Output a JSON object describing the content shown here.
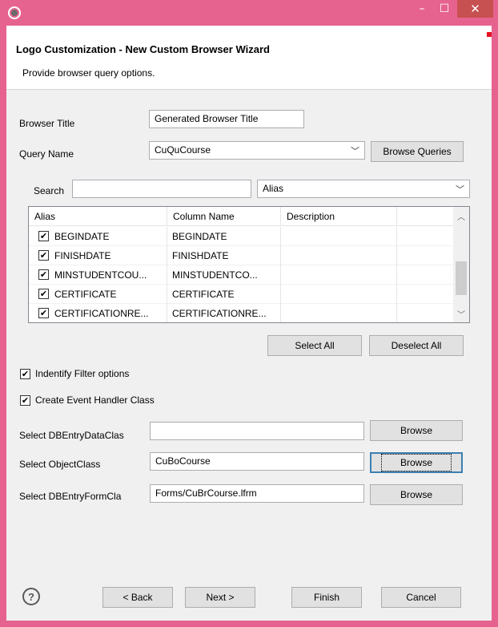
{
  "window": {
    "title": "",
    "controls": {
      "minimize": "–",
      "maximize": "☐",
      "close": "✕"
    }
  },
  "header": {
    "title": "Logo Customization - New Custom Browser Wizard",
    "subtitle": "Provide browser query options."
  },
  "form": {
    "browser_title_label": "Browser Title",
    "browser_title_value": "Generated Browser Title",
    "query_name_label": "Query Name",
    "query_name_value": "CuQuCourse",
    "browse_queries_button": "Browse Queries",
    "search_label": "Search",
    "search_value": "",
    "search_by_value": "Alias"
  },
  "table": {
    "columns": [
      "Alias",
      "Column Name",
      "Description"
    ],
    "rows": [
      {
        "checked": true,
        "alias": "BEGINDATE",
        "column_name": "BEGINDATE",
        "description": ""
      },
      {
        "checked": true,
        "alias": "FINISHDATE",
        "column_name": "FINISHDATE",
        "description": ""
      },
      {
        "checked": true,
        "alias": "MINSTUDENTCOU...",
        "column_name": "MINSTUDENTCO...",
        "description": ""
      },
      {
        "checked": true,
        "alias": "CERTIFICATE",
        "column_name": "CERTIFICATE",
        "description": ""
      },
      {
        "checked": true,
        "alias": "CERTIFICATIONRE...",
        "column_name": "CERTIFICATIONRE...",
        "description": ""
      }
    ]
  },
  "selection": {
    "select_all": "Select All",
    "deselect_all": "Deselect All"
  },
  "options": {
    "identify_filter": {
      "label": "Indentify Filter options",
      "checked": true
    },
    "create_event_handler": {
      "label": "Create Event Handler Class",
      "checked": true
    }
  },
  "classes": {
    "dbentry_data_label": "Select DBEntryDataClas",
    "dbentry_data_value": "",
    "object_class_label": "Select ObjectClass",
    "object_class_value": "CuBoCourse",
    "dbentry_form_label": "Select DBEntryFormCla",
    "dbentry_form_value": "Forms/CuBrCourse.lfrm",
    "browse_button": "Browse"
  },
  "footer": {
    "help_icon": "?",
    "back": "Back",
    "next": "Next >",
    "finish": "Finish",
    "cancel": "Cancel"
  },
  "icons": {
    "check": "✔",
    "dropdown": "chevron-down-icon"
  },
  "colors": {
    "title_bar": "#e6638f",
    "close_button": "#c75050",
    "dialog_bg": "#f0f0f0"
  }
}
